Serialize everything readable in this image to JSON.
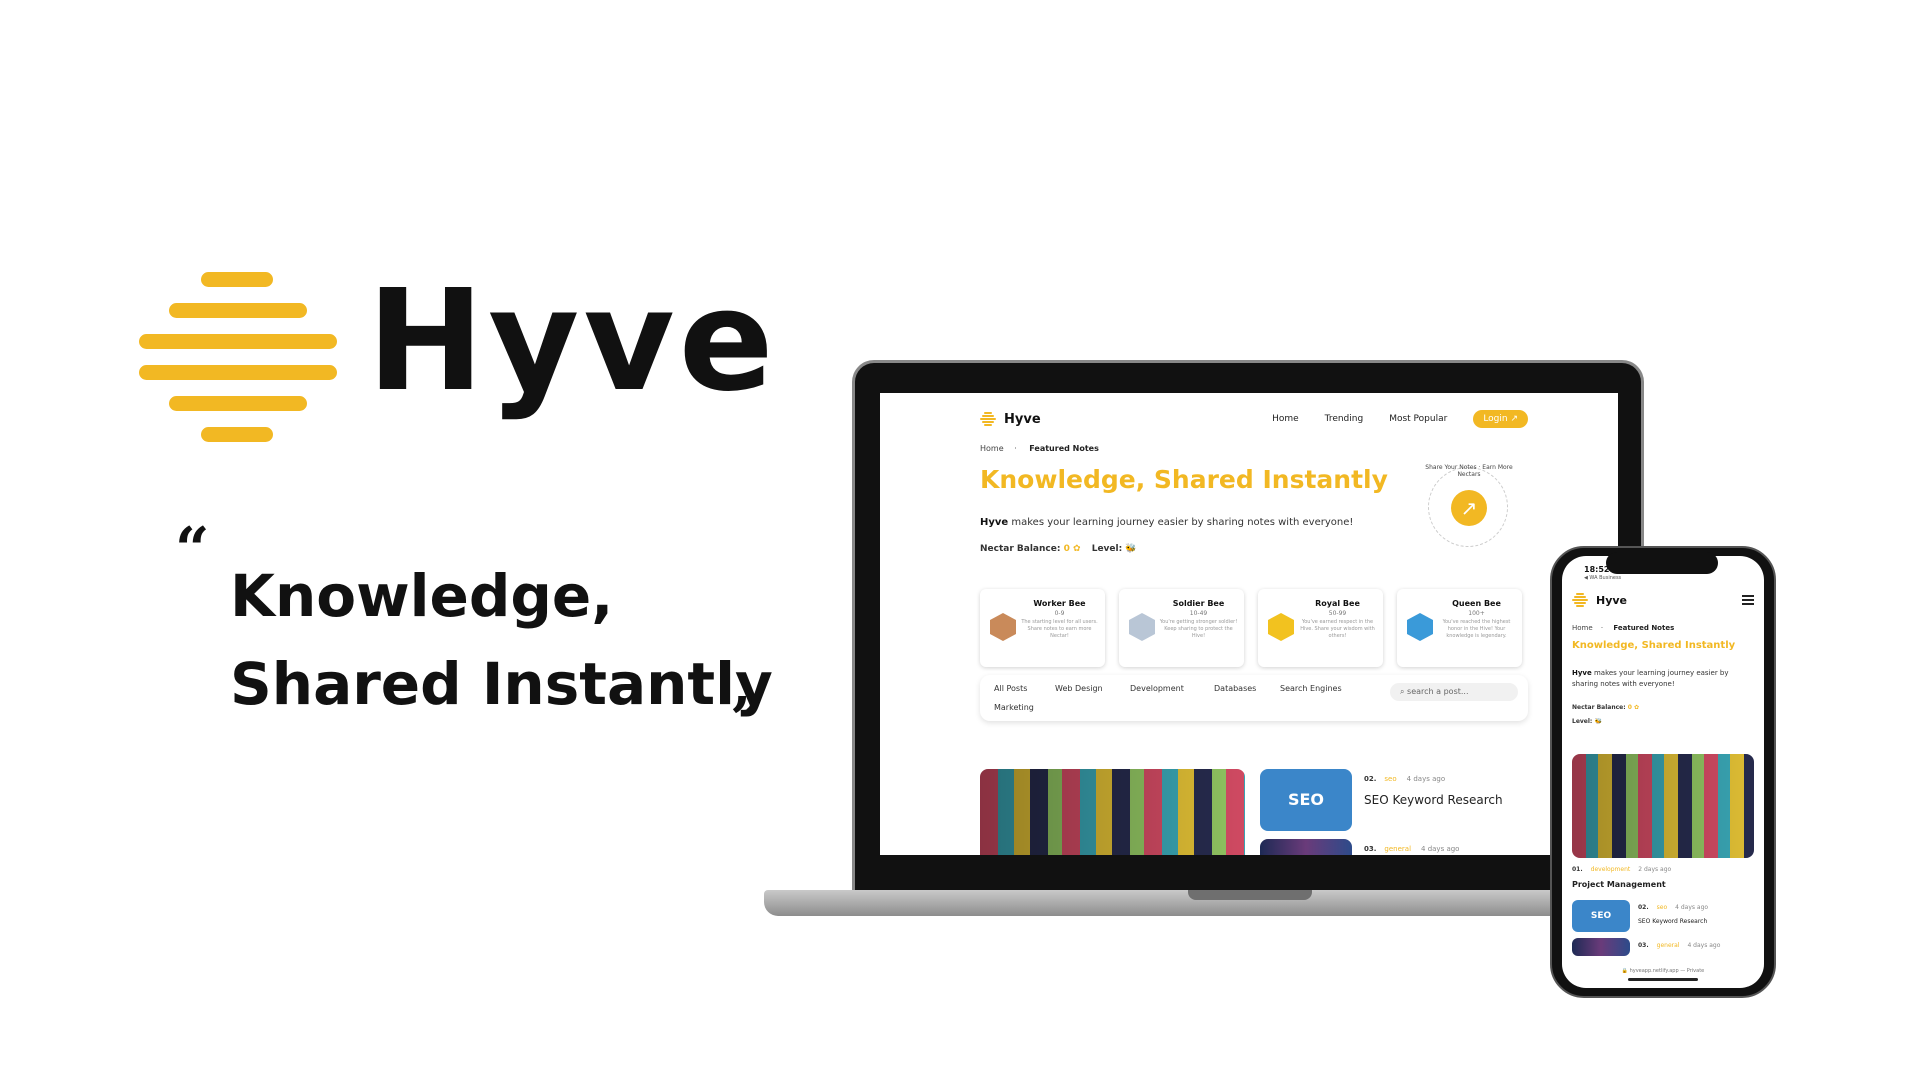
{
  "brand": {
    "name": "Hyve",
    "accent_color": "#F2B823",
    "logo_icon": "honeycomb-bars-icon"
  },
  "tagline": {
    "open_quote": "“",
    "line1": "Knowledge,",
    "line2": "Shared Instantly",
    "close_quote": "”"
  },
  "laptop": {
    "nav": {
      "brand": "Hyve",
      "links": [
        "Home",
        "Trending",
        "Most Popular"
      ],
      "login": "Login ↗"
    },
    "breadcrumb": {
      "home": "Home",
      "separator": "·",
      "current": "Featured Notes"
    },
    "hero_title": "Knowledge, Shared Instantly",
    "hero_subtitle_brand": "Hyve",
    "hero_subtitle_rest": " makes your learning journey easier by sharing notes with everyone!",
    "nectar_label": "Nectar Balance:",
    "nectar_value": "0",
    "level_label": "Level:",
    "badge_text": "Share Your Notes · Earn More Nectars",
    "badge_arrow": "↗",
    "ranks": [
      {
        "title": "Worker Bee",
        "range": "0-9",
        "desc": "The starting level for all users. Share notes to earn more Nectar!",
        "color": "#c98a5a"
      },
      {
        "title": "Soldier Bee",
        "range": "10-49",
        "desc": "You're getting stronger soldier! Keep sharing to protect the Hive!",
        "color": "#b9c6d6"
      },
      {
        "title": "Royal Bee",
        "range": "50-99",
        "desc": "You've earned respect in the Hive. Share your wisdom with others!",
        "color": "#F2C21F"
      },
      {
        "title": "Queen Bee",
        "range": "100+",
        "desc": "You've reached the highest honor in the Hive! Your knowledge is legendary.",
        "color": "#3a9ad9"
      }
    ],
    "tabs": [
      "All Posts",
      "Web Design",
      "Development",
      "Databases",
      "Search Engines",
      "Marketing"
    ],
    "search_placeholder": "search a post...",
    "posts": [
      {
        "number": "02.",
        "category": "seo",
        "time": "4 days ago",
        "title": "SEO Keyword Research",
        "image_text": "SEO"
      },
      {
        "number": "03.",
        "category": "general",
        "time": "4 days ago"
      }
    ]
  },
  "phone": {
    "status_time": "18:52",
    "status_app": "◀ WA Business",
    "nav_brand": "Hyve",
    "breadcrumb": {
      "home": "Home",
      "separator": "·",
      "current": "Featured Notes"
    },
    "hero_title": "Knowledge, Shared Instantly",
    "hero_subtitle_brand": "Hyve",
    "hero_subtitle_rest": " makes your learning journey easier by sharing notes with everyone!",
    "nectar_label": "Nectar Balance:",
    "nectar_value": "0",
    "level_label": "Level:",
    "posts": [
      {
        "number": "01.",
        "category": "development",
        "time": "2 days ago",
        "title": "Project Management"
      },
      {
        "number": "02.",
        "category": "seo",
        "time": "4 days ago",
        "title": "SEO Keyword Research",
        "image_text": "SEO"
      },
      {
        "number": "03.",
        "category": "general",
        "time": "4 days ago"
      }
    ],
    "url": "🔒 hyveapp.netlify.app — Private"
  }
}
